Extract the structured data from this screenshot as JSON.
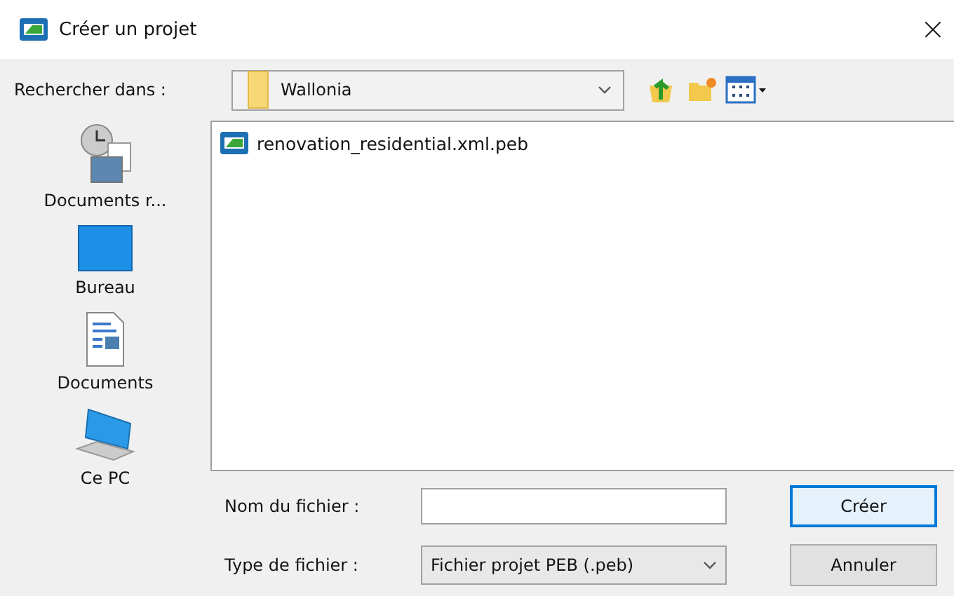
{
  "window": {
    "title": "Créer un projet",
    "close": "×"
  },
  "look_in": {
    "label": "Rechercher dans :",
    "value": "Wallonia"
  },
  "places": [
    {
      "label": "Documents r...",
      "kind": "recent"
    },
    {
      "label": "Bureau",
      "kind": "desktop"
    },
    {
      "label": "Documents",
      "kind": "documents"
    },
    {
      "label": "Ce PC",
      "kind": "computer"
    }
  ],
  "files": [
    {
      "name": "renovation_residential.xml.peb",
      "selected": false
    }
  ],
  "file_name": {
    "label": "Nom du fichier :"
  },
  "file_type": {
    "label": "Type de fichier :",
    "value": "Fichier projet PEB (.peb)"
  },
  "buttons": [
    {
      "label": "Créer",
      "kind": "default"
    },
    {
      "label": "Annuler",
      "kind": "normal"
    }
  ]
}
